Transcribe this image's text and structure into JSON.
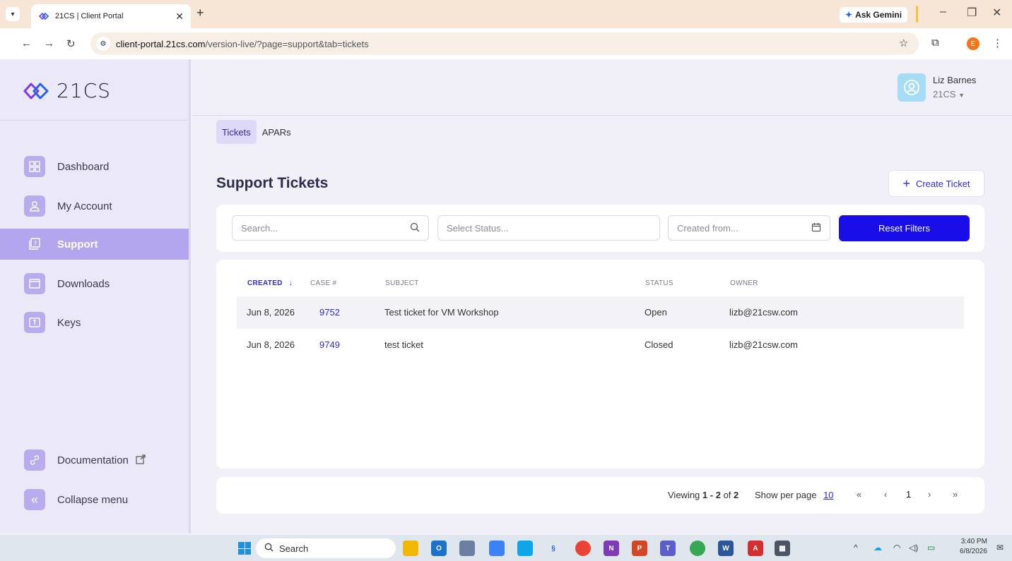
{
  "browser": {
    "tab_title": "21CS | Client Portal",
    "tab_close": "✕",
    "new_tab": "+",
    "gemini_label": "Ask Gemini",
    "url_host": "client-portal.21cs.com",
    "url_path": "/version-live/?page=support&tab=tickets",
    "profile_initial": "E"
  },
  "logo": {
    "text": "21CS"
  },
  "sidebar": {
    "items": [
      {
        "label": "Dashboard",
        "icon": "grid-icon"
      },
      {
        "label": "My Account",
        "icon": "user-icon"
      },
      {
        "label": "Support",
        "icon": "support-icon",
        "active": true
      },
      {
        "label": "Downloads",
        "icon": "folder-icon"
      },
      {
        "label": "Keys",
        "icon": "key-icon"
      }
    ],
    "documentation": "Documentation",
    "collapse": "Collapse menu"
  },
  "user": {
    "name": "Liz Barnes",
    "org": "21CS"
  },
  "subtabs": {
    "tickets": "Tickets",
    "apars": "APARs"
  },
  "page": {
    "title": "Support Tickets",
    "create_label": "Create Ticket"
  },
  "filters": {
    "search_placeholder": "Search...",
    "status_placeholder": "Select Status...",
    "created_placeholder": "Created from...",
    "reset_label": "Reset Filters"
  },
  "table": {
    "headers": {
      "created": "CREATED",
      "case": "CASE #",
      "subject": "SUBJECT",
      "status": "STATUS",
      "owner": "OWNER"
    },
    "rows": [
      {
        "created": "Jun 8, 2026",
        "case": "9752",
        "subject": "Test ticket for VM Workshop",
        "status": "Open",
        "owner": "lizb@21csw.com"
      },
      {
        "created": "Jun 8, 2026",
        "case": "9749",
        "subject": "test ticket",
        "status": "Closed",
        "owner": "lizb@21csw.com"
      }
    ]
  },
  "pagination": {
    "viewing_prefix": "Viewing",
    "range": "1 - 2",
    "of_label": "of",
    "total": "2",
    "per_page_label": "Show per page",
    "per_page": "10",
    "current_page": "1"
  },
  "taskbar": {
    "search_label": "Search",
    "time": "3:40 PM",
    "date": "6/8/2026"
  },
  "colors": {
    "accent": "#1a0ee8",
    "sidebar_active": "#b3a6ee",
    "link": "#2f2ad6"
  }
}
